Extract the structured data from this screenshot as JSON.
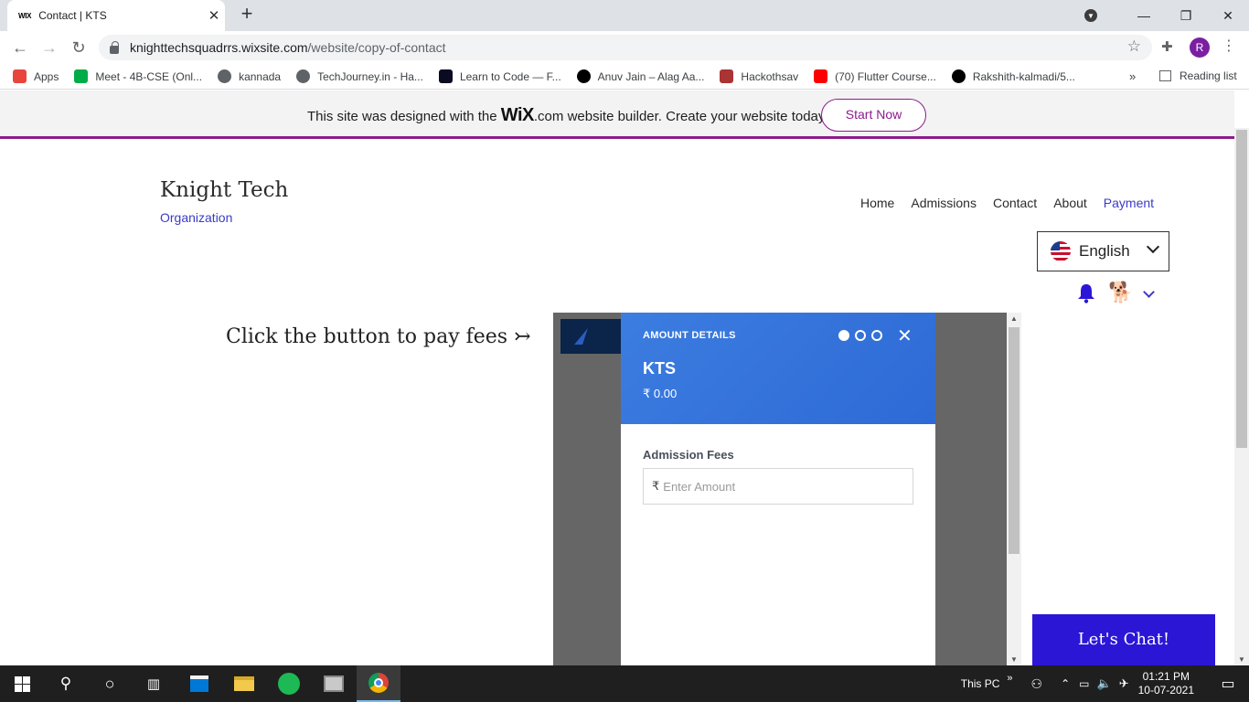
{
  "browser": {
    "tab_title": "Contact | KTS",
    "tab_favicon": "WIX",
    "url_host": "knighttechsquadrrs.wixsite.com",
    "url_path": "/website/copy-of-contact",
    "profile_initial": "R",
    "bookmarks": [
      {
        "label": "Apps",
        "icon": "apps-grid-icon",
        "color": "#e8453c"
      },
      {
        "label": "Meet - 4B-CSE (Onl...",
        "icon": "meet-icon",
        "color": "#00ac47"
      },
      {
        "label": "kannada",
        "icon": "globe-icon",
        "color": "#5f6368"
      },
      {
        "label": "TechJourney.in - Ha...",
        "icon": "globe-icon",
        "color": "#5f6368"
      },
      {
        "label": "Learn to Code — F...",
        "icon": "freecodecamp-icon",
        "color": "#0a0a23"
      },
      {
        "label": "Anuv Jain – Alag Aa...",
        "icon": "genius-icon",
        "color": "#000000"
      },
      {
        "label": "Hackothsav",
        "icon": "hackothsav-icon",
        "color": "#a33"
      },
      {
        "label": "(70) Flutter Course...",
        "icon": "youtube-icon",
        "color": "#ff0000"
      },
      {
        "label": "Rakshith-kalmadi/5...",
        "icon": "github-icon",
        "color": "#000000"
      }
    ],
    "bookmarks_more": "»",
    "reading_list": "Reading list"
  },
  "wix_banner": {
    "text_before": "This site was designed with the",
    "wix_logo": "WiX",
    "text_after": ".com website builder. Create your website today.",
    "start_now": "Start Now",
    "accent": "#8d1b8d"
  },
  "site": {
    "brand": "Knight Tech",
    "brand_sub": "Organization",
    "nav": [
      "Home",
      "Admissions",
      "Contact",
      "About",
      "Payment"
    ],
    "language": "English",
    "pay_prompt": "Click the button to pay fees ↣",
    "chat_label": "Let's Chat!",
    "accent": "#3b3bc8",
    "chat_color": "#2b16d6"
  },
  "payment_modal": {
    "section_label": "AMOUNT DETAILS",
    "close": "✕",
    "merchant": "KTS",
    "amount": "₹ 0.00",
    "field_label": "Admission Fees",
    "currency_symbol": "₹",
    "amount_placeholder": "Enter Amount",
    "amount_value": "",
    "steps_total": 3,
    "step_active": 1,
    "header_color": "#3c7de0"
  },
  "taskbar": {
    "this_pc": "This PC",
    "time": "01:21 PM",
    "date": "10-07-2021"
  }
}
